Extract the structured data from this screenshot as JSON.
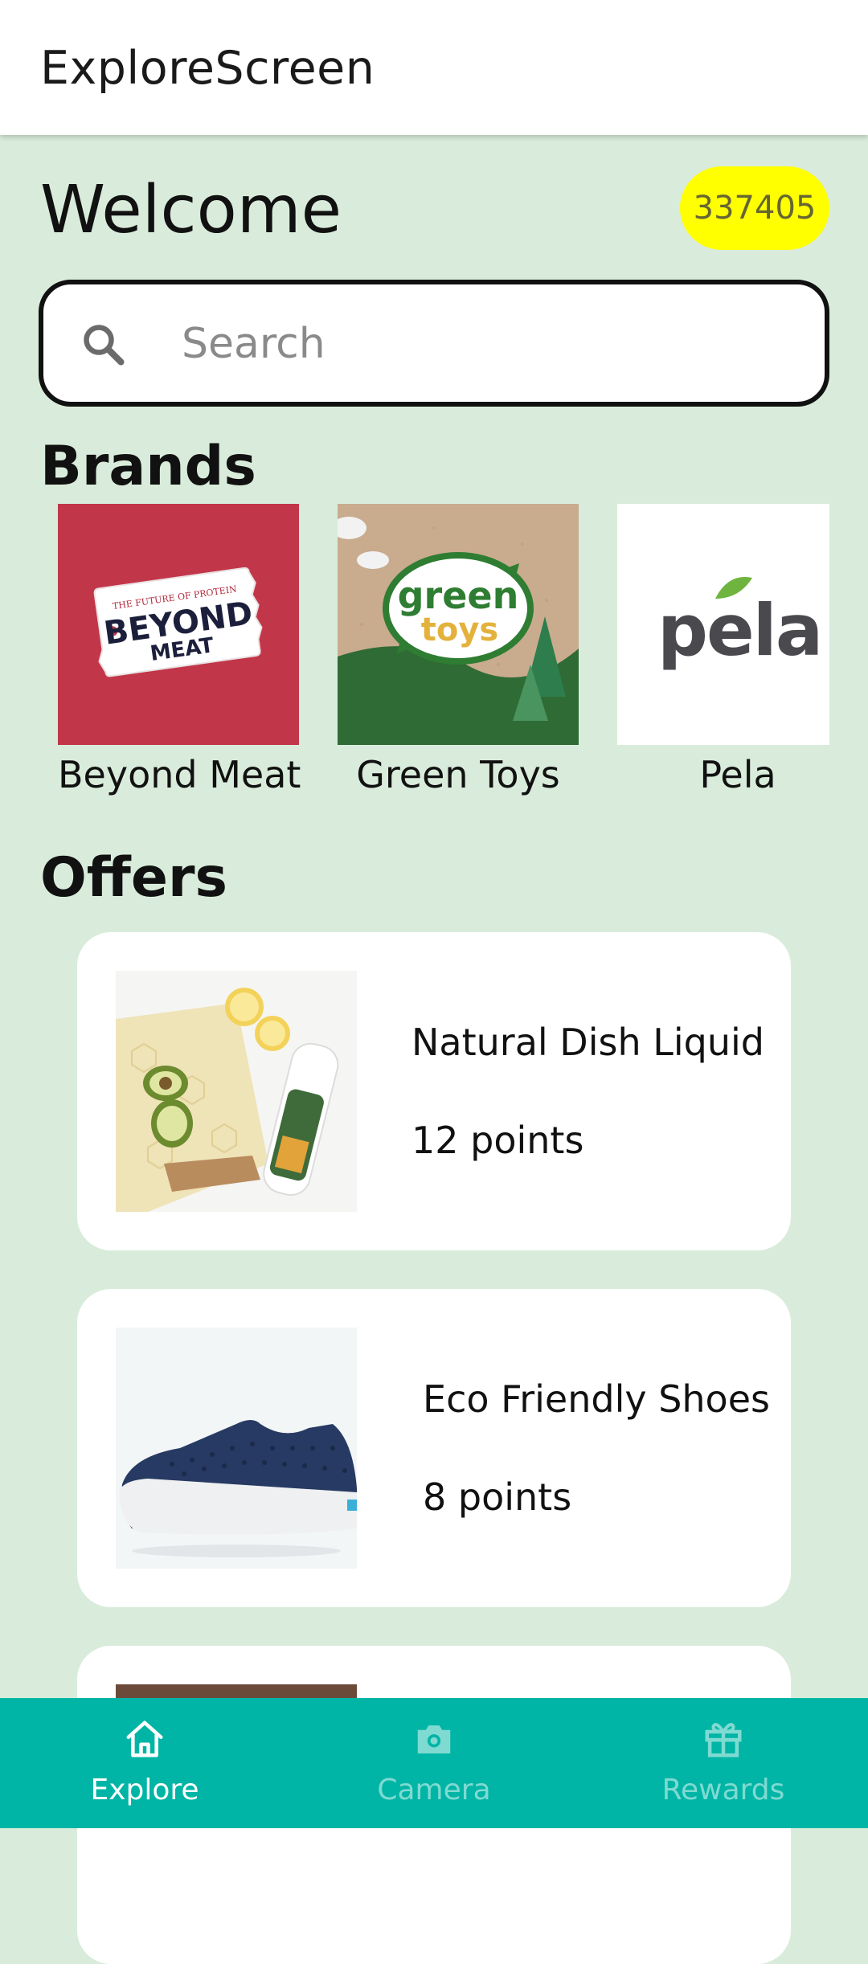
{
  "appbar": {
    "title": "ExploreScreen"
  },
  "header": {
    "welcome": "Welcome",
    "points_badge": "337405"
  },
  "search": {
    "placeholder": "Search",
    "icon": "search-icon"
  },
  "brands": {
    "title": "Brands",
    "items": [
      {
        "label": "Beyond Meat",
        "logo_text": [
          "THE FUTURE OF PROTEIN",
          "BEYOND",
          "MEAT"
        ]
      },
      {
        "label": "Green Toys",
        "logo_text": [
          "green",
          "toys"
        ]
      },
      {
        "label": "Pela",
        "logo_text": [
          "pela"
        ]
      }
    ]
  },
  "offers": {
    "title": "Offers",
    "items": [
      {
        "name": "Natural Dish Liquid",
        "points": "12 points"
      },
      {
        "name": "Eco Friendly Shoes",
        "points": "8 points"
      }
    ]
  },
  "nav": {
    "items": [
      {
        "label": "Explore",
        "icon": "home-icon",
        "active": true
      },
      {
        "label": "Camera",
        "icon": "camera-icon",
        "active": false
      },
      {
        "label": "Rewards",
        "icon": "gift-icon",
        "active": false
      }
    ]
  },
  "colors": {
    "background": "#d9ecdb",
    "badge": "#ffff00",
    "nav": "#00b5a5",
    "nav_active": "#ffffff",
    "nav_inactive": "#7fdad2"
  }
}
